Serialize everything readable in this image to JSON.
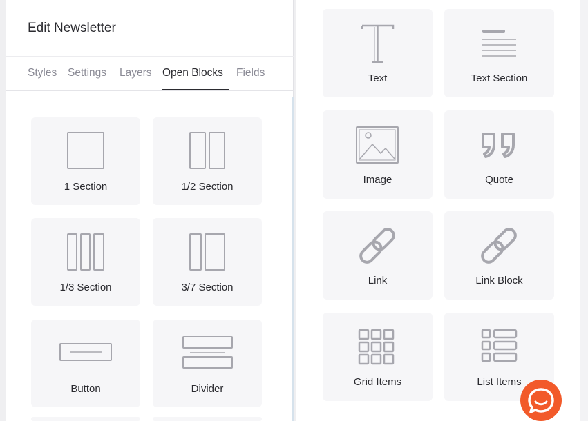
{
  "header": {
    "title": "Edit Newsletter"
  },
  "tabs": [
    {
      "label": "Styles"
    },
    {
      "label": "Settings"
    },
    {
      "label": "Layers"
    },
    {
      "label": "Open Blocks",
      "active": true
    },
    {
      "label": "Fields"
    }
  ],
  "layout_blocks": [
    {
      "label": "1 Section",
      "icon": "one-section-icon"
    },
    {
      "label": "1/2 Section",
      "icon": "half-section-icon"
    },
    {
      "label": "1/3 Section",
      "icon": "third-section-icon"
    },
    {
      "label": "3/7 Section",
      "icon": "three-seven-section-icon"
    },
    {
      "label": "Button",
      "icon": "button-icon"
    },
    {
      "label": "Divider",
      "icon": "divider-icon"
    }
  ],
  "content_blocks": [
    {
      "label": "Text",
      "icon": "text-icon"
    },
    {
      "label": "Text Section",
      "icon": "text-section-icon"
    },
    {
      "label": "Image",
      "icon": "image-icon"
    },
    {
      "label": "Quote",
      "icon": "quote-icon"
    },
    {
      "label": "Link",
      "icon": "link-icon"
    },
    {
      "label": "Link Block",
      "icon": "link-block-icon"
    },
    {
      "label": "Grid Items",
      "icon": "grid-items-icon"
    },
    {
      "label": "List Items",
      "icon": "list-items-icon"
    }
  ],
  "colors": {
    "icon": "#a7a7ae",
    "block_bg": "#f6f6f8",
    "chat": "#f25a2a",
    "active_tab": "#2b2b30"
  },
  "chat": {
    "icon": "chat-bubble-icon"
  }
}
